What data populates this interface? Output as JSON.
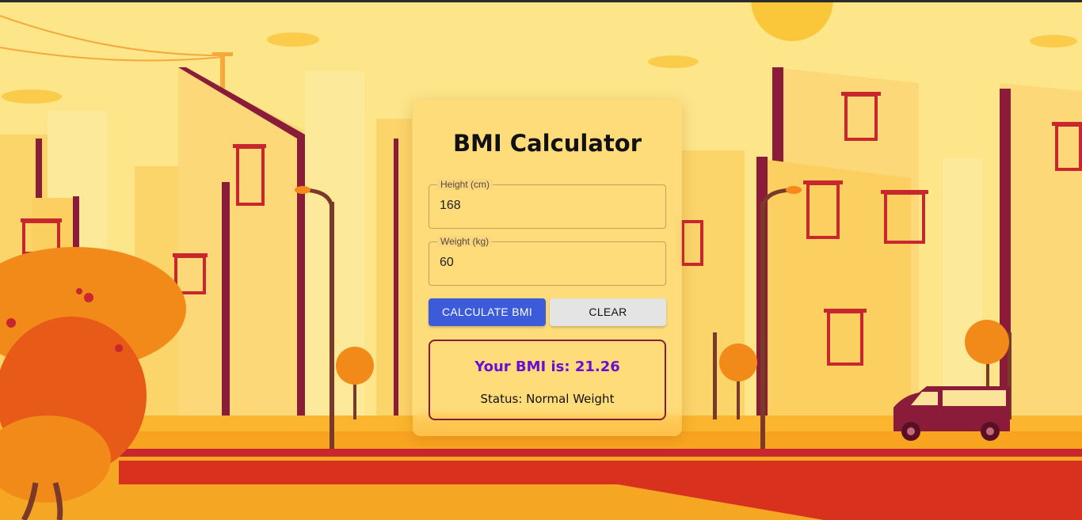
{
  "app": {
    "title": "BMI Calculator"
  },
  "form": {
    "height": {
      "label": "Height (cm)",
      "value": "168"
    },
    "weight": {
      "label": "Weight (kg)",
      "value": "60"
    }
  },
  "buttons": {
    "calculate_label": "CALCULATE BMI",
    "clear_label": "CLEAR"
  },
  "result": {
    "bmi_text": "Your BMI is: 21.26",
    "status_text": "Status: Normal Weight"
  },
  "colors": {
    "sky": "#fde58a",
    "accent_button": "#3b5bdb",
    "result_border": "#8a1c32",
    "bmi_text": "#6a0dd6",
    "road": "#d8321e",
    "tree": "#f28a1a",
    "building_trim": "#8a1c3a"
  }
}
